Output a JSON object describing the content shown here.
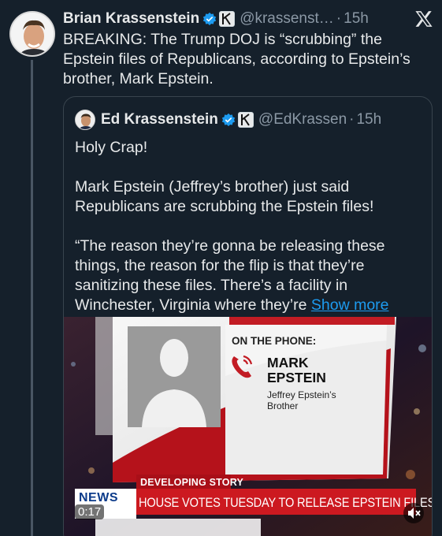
{
  "main_tweet": {
    "author_name": "Brian Krassenstein",
    "handle": "@krassenst…",
    "separator": "·",
    "time": "15h",
    "text": "BREAKING:  The Trump DOJ is “scrubbing” the Epstein files of Republicans, according to Epstein’s brother, Mark Epstein."
  },
  "quoted_tweet": {
    "author_name": "Ed Krassenstein",
    "handle": "@EdKrassen",
    "separator": "·",
    "time": "15h",
    "paragraphs": [
      "Holy Crap!",
      "Mark Epstein (Jeffrey’s brother) just said Republicans are scrubbing the Epstein files!"
    ],
    "last_paragraph": "“The reason they’re gonna be releasing these things, the reason for the flip is that they’re sanitizing these files. There’s a facility in Winchester, Virginia where they’re ",
    "show_more": "Show more"
  },
  "video": {
    "phone_label": "ON THE PHONE:",
    "caller_name_line1": "MARK",
    "caller_name_line2": "EPSTEIN",
    "caller_desc_line1": "Jeffrey Epstein’s",
    "caller_desc_line2": "Brother",
    "banner_label": "DEVELOPING STORY",
    "headline": "HOUSE VOTES TUESDAY TO RELEASE EPSTEIN FILES",
    "network_logo": "NEWS",
    "timestamp": "0:17",
    "icons": [
      "verified-badge-icon",
      "affiliate-k-icon",
      "x-logo-icon",
      "phone-icon",
      "mute-icon"
    ],
    "colors": {
      "accent": "#1d9bf0",
      "banner_red": "#c4161c",
      "background": "#15202b"
    }
  }
}
